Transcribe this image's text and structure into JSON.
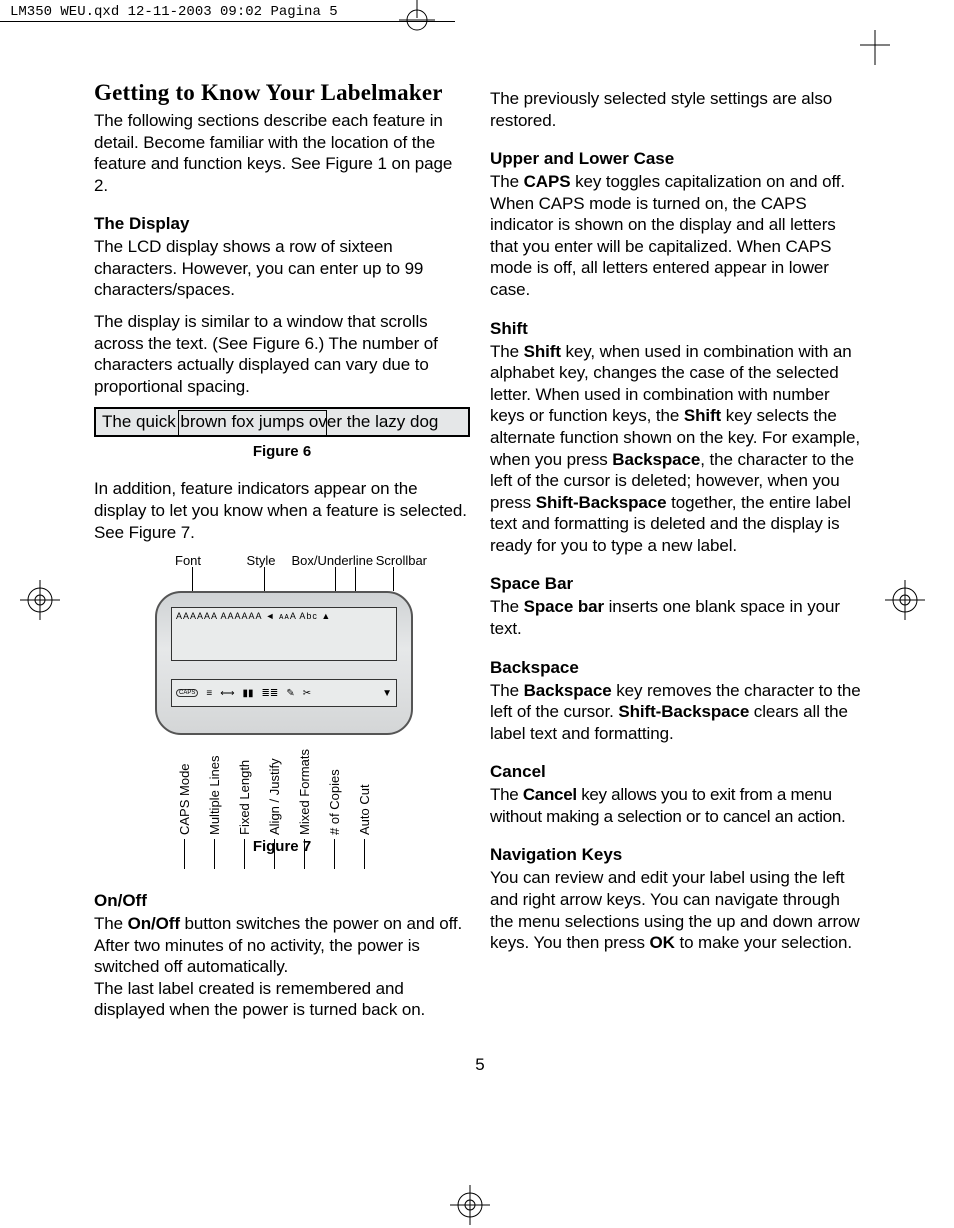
{
  "printHeader": "LM350 WEU.qxd  12-11-2003  09:02  Pagina 5  ",
  "pageNumber": "5",
  "left": {
    "h1": "Getting to Know Your Labelmaker",
    "intro": "The following sections describe each feature in detail. Become familiar with the location of the feature and function keys. See Figure 1 on page 2.",
    "display_h": "The Display",
    "display_p1": "The LCD display shows a row of sixteen characters. However, you can enter up to 99 characters/spaces.",
    "display_p2": "The display is similar to a window that scrolls across the text. (See Figure 6.) The number of characters actually displayed can vary due to proportional spacing.",
    "lcd_text": "The quick brown fox jumps over the lazy dog",
    "figure6": "Figure 6",
    "display_p3": "In addition, feature indicators appear on the display to let you know when a feature is selected. See Figure 7.",
    "fig7_top": {
      "font": "Font",
      "style": "Style",
      "box": "Box/Underline",
      "scroll": "Scrollbar"
    },
    "fig7_bottom": [
      "CAPS Mode",
      "Multiple Lines",
      "Fixed Length",
      "Align / Justify",
      "Mixed Formats",
      "# of Copies",
      "Auto Cut"
    ],
    "fig7_screen1": "AAAAAA AAAAAA ◄ ᴀᴀA  Abc ▲",
    "fig7_screen2_caps": "CAPS",
    "figure7": "Figure 7",
    "onoff_h": "On/Off",
    "onoff_p1_a": "The ",
    "onoff_p1_b": "On/Off",
    "onoff_p1_c": " button switches the power on and off. After two minutes of no activity, the power is switched off automatically.",
    "onoff_p2": "The last label created is remembered and displayed when the power is turned back on."
  },
  "right": {
    "cont": "The previously selected style settings are also restored.",
    "upper_h": "Upper and Lower Case",
    "upper_a": "The ",
    "upper_b": "CAPS",
    "upper_c": " key toggles capitalization on and off. When CAPS mode is turned on, the CAPS indicator is shown on the display and all letters that you enter will be capitalized. When CAPS mode is off, all letters entered appear in lower case.",
    "shift_h": "Shift",
    "shift_a": "The ",
    "shift_b": "Shift",
    "shift_c": " key, when used in combination with an alphabet key, changes the case of the selected letter. When used in combination with number keys or function keys, the ",
    "shift_d": "Shift",
    "shift_e": " key selects the alternate function shown on the key. For example, when you press ",
    "shift_f": "Backspace",
    "shift_g": ", the character to the left of the cursor is deleted; however, when you press ",
    "shift_h2": "Shift-Backspace",
    "shift_i": " together, the entire label text and formatting is deleted and the display is ready for you to type a new label.",
    "space_h": "Space Bar",
    "space_a": "The ",
    "space_b": "Space bar",
    "space_c": " inserts one blank space in your text.",
    "back_h": "Backspace",
    "back_a": "The ",
    "back_b": "Backspace",
    "back_c": " key removes the character to the left of the cursor. ",
    "back_d": "Shift-Backspace",
    "back_e": " clears all the label text and formatting.",
    "cancel_h": "Cancel",
    "cancel_a": "The ",
    "cancel_b": "Cancel",
    "cancel_c": " key allows you to exit from a menu without making a selection or to cancel an action.",
    "nav_h": "Navigation Keys",
    "nav_a": "You can review and edit your label using the left and right arrow keys. You can navigate through the menu selections using the up and down arrow keys. You then press ",
    "nav_b": "OK",
    "nav_c": " to make your selection."
  }
}
